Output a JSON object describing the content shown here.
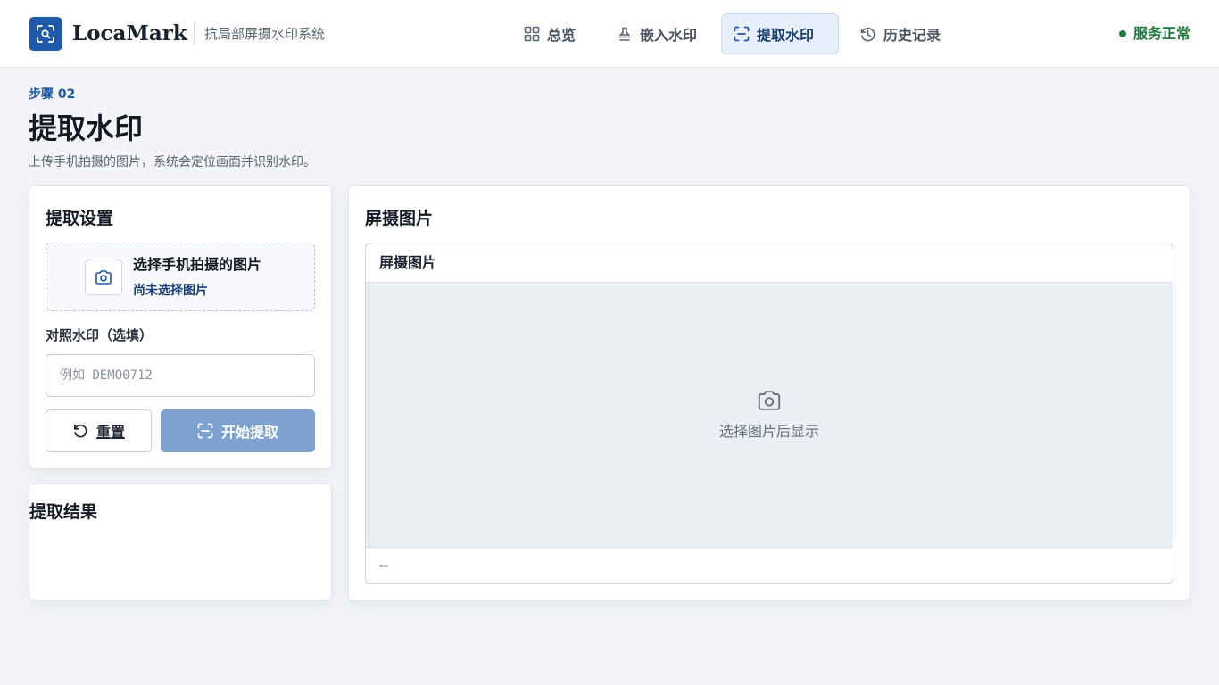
{
  "header": {
    "brand": "LocaMark",
    "subtitle": "抗局部屏摄水印系统",
    "nav": [
      {
        "label": "总览",
        "icon": "grid-icon",
        "active": false
      },
      {
        "label": "嵌入水印",
        "icon": "stamp-icon",
        "active": false
      },
      {
        "label": "提取水印",
        "icon": "scan-icon",
        "active": true
      },
      {
        "label": "历史记录",
        "icon": "history-icon",
        "active": false
      }
    ],
    "status": "服务正常",
    "status_color": "#1f7a3e"
  },
  "page": {
    "step": "步骤 02",
    "title": "提取水印",
    "description": "上传手机拍摄的图片，系统会定位画面并识别水印。"
  },
  "settings": {
    "title": "提取设置",
    "upload_title": "选择手机拍摄的图片",
    "upload_status": "尚未选择图片",
    "upload_icon": "camera-icon",
    "watermark_label": "对照水印（选填）",
    "watermark_placeholder": "例如 DEMO0712",
    "watermark_value": "",
    "reset_label": "重置",
    "start_label": "开始提取"
  },
  "result": {
    "title": "提取结果"
  },
  "preview": {
    "panel_title": "屏摄图片",
    "frame_title": "屏摄图片",
    "empty_text": "选择图片后显示",
    "footer_text": "--"
  },
  "colors": {
    "accent": "#1f5aa8",
    "button_disabled": "#7da2cf",
    "background": "#f2f4f8"
  }
}
